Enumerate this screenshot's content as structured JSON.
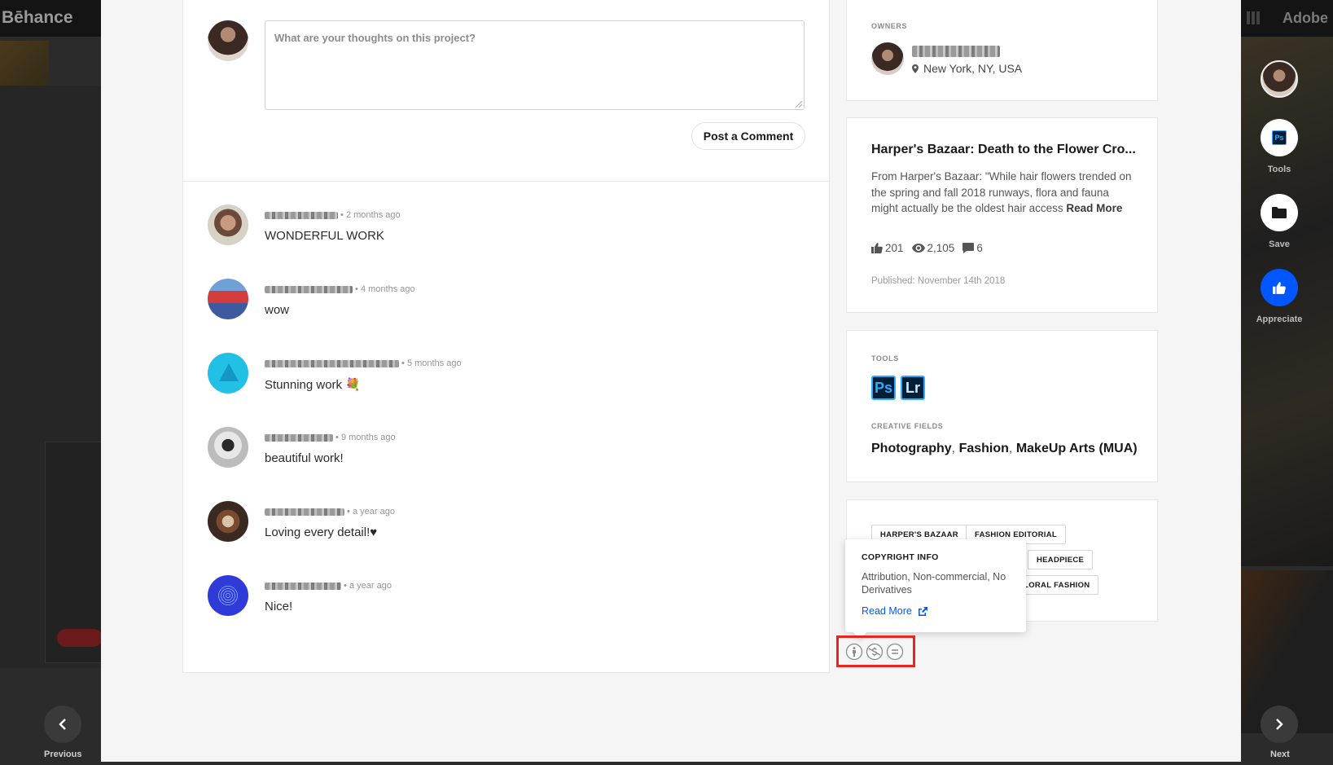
{
  "background": {
    "logo": "Bēhance",
    "adobe": "Adobe"
  },
  "comment_form": {
    "placeholder": "What are your thoughts on this project?",
    "post_label": "Post a Comment"
  },
  "comments": [
    {
      "time": "2 months ago",
      "text": "WONDERFUL WORK"
    },
    {
      "time": "4 months ago",
      "text": "wow"
    },
    {
      "time": "5 months ago",
      "text": "Stunning work 💐"
    },
    {
      "time": "9 months ago",
      "text": "beautiful work!"
    },
    {
      "time": "a year ago",
      "text": "Loving every detail!♥"
    },
    {
      "time": "a year ago",
      "text": "Nice!"
    }
  ],
  "owners": {
    "label": "OWNERS",
    "location": "New York, NY, USA"
  },
  "project": {
    "title": "Harper's Bazaar: Death to the Flower Cro...",
    "description": "From Harper's Bazaar: \"While hair flowers trended on the spring and fall 2018 runways, flora and fauna might actually be the oldest hair access",
    "read_more": "Read More",
    "appreciations": "201",
    "views": "2,105",
    "comments": "6",
    "published": "Published: November 14th 2018"
  },
  "tools": {
    "label": "TOOLS",
    "items": [
      "Ps",
      "Lr"
    ],
    "fields_label": "CREATIVE FIELDS",
    "fields": [
      "Photography",
      "Fashion",
      "MakeUp Arts (MUA)"
    ],
    "field_separator": ","
  },
  "tags": [
    "HARPER'S BAZAAR",
    "FASHION EDITORIAL",
    "HEADPIECE",
    "FLORAL FASHION"
  ],
  "copyright": {
    "title": "COPYRIGHT INFO",
    "body": "Attribution, Non-commercial, No Derivatives",
    "link": "Read More"
  },
  "sidebar": {
    "tools_label": "Tools",
    "save_label": "Save",
    "appreciate_label": "Appreciate"
  },
  "navigation": {
    "previous": "Previous",
    "next": "Next"
  },
  "colors": {
    "accent": "#0057ff",
    "highlight": "#e8251e"
  }
}
